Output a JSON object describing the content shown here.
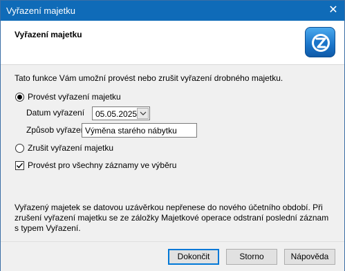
{
  "window": {
    "title": "Vyřazení majetku",
    "close_glyph": "✕"
  },
  "header": {
    "heading": "Vyřazení majetku",
    "logo_icon": "app-logo-icon"
  },
  "description": "Tato funkce Vám umožní provést nebo zrušit vyřazení drobného majetku.",
  "options": {
    "perform_label": "Provést vyřazení majetku",
    "perform_checked": true,
    "date_label": "Datum vyřazení",
    "date_value": "05.05.2025",
    "method_label": "Způsob vyřazení",
    "method_value": "Výměna starého nábytku",
    "cancel_label": "Zrušit vyřazení majetku",
    "cancel_checked": false,
    "all_records_label": "Provést pro všechny záznamy ve výběru",
    "all_records_checked": true
  },
  "note": "Vyřazený majetek se datovou uzávěrkou nepřenese do nového účetního období. Při zrušení vyřazení majetku se ze záložky Majetkové operace odstraní poslední záznam s typem Vyřazení.",
  "buttons": {
    "finish": "Dokončit",
    "cancel": "Storno",
    "help": "Nápověda"
  },
  "colors": {
    "titlebar": "#0f6bb8",
    "accent": "#0078d7",
    "logo": "#1a74c9"
  }
}
